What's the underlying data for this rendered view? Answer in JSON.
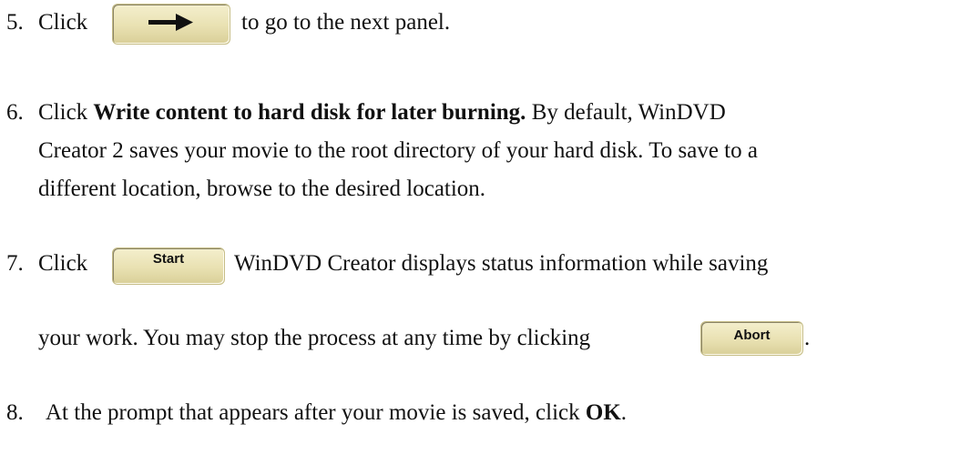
{
  "steps": [
    {
      "number": "5.",
      "before_button": "Click",
      "after_button": "to go to the next panel."
    },
    {
      "number": "6.",
      "prefix": "Click ",
      "bold": "Write content to hard disk for later burning.",
      "rest_line1": " By default, WinDVD",
      "line2": "Creator 2 saves your movie to the root directory of your hard disk. To save to a",
      "line3": "different location, browse to the desired location."
    },
    {
      "number": "7.",
      "before_button": "Click",
      "after_button": "WinDVD Creator displays status information while saving",
      "line2": "your work. You may stop the process at any time by clicking",
      "end": "."
    },
    {
      "number": "8.",
      "text": "At the prompt that appears after your movie is saved, click ",
      "bold": "OK",
      "end": "."
    }
  ],
  "buttons": {
    "next": {
      "icon": "right-arrow-icon"
    },
    "start": {
      "label": "Start"
    },
    "abort": {
      "label": "Abort"
    }
  }
}
